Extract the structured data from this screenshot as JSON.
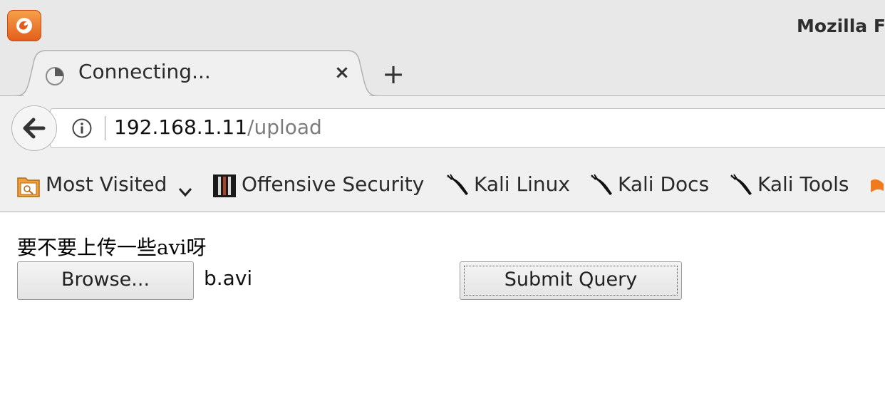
{
  "window": {
    "title": "Mozilla F"
  },
  "tabs": [
    {
      "label": "Connecting...",
      "icon": "loading-throbber-icon",
      "close_label": "×"
    }
  ],
  "new_tab_label": "+",
  "navigation": {
    "back_icon": "back-arrow-icon",
    "info_icon": "info-icon",
    "url_host": "192.168.1.11",
    "url_path": "/upload"
  },
  "bookmarks": [
    {
      "label": "Most Visited",
      "icon": "folder-icon",
      "has_dropdown": true
    },
    {
      "label": "Offensive Security",
      "icon": "offsec-logo-icon"
    },
    {
      "label": "Kali Linux",
      "icon": "kali-dragon-icon"
    },
    {
      "label": "Kali Docs",
      "icon": "kali-dragon-icon"
    },
    {
      "label": "Kali Tools",
      "icon": "kali-dragon-icon"
    }
  ],
  "page": {
    "prompt": "要不要上传一些avi呀",
    "browse_label": "Browse...",
    "file_name": "b.avi",
    "submit_label": "Submit Query"
  },
  "colors": {
    "chrome_background": "#e8e8e8",
    "toolbar_background": "#f0f0f0",
    "firefox_orange": "#e25d1b"
  }
}
